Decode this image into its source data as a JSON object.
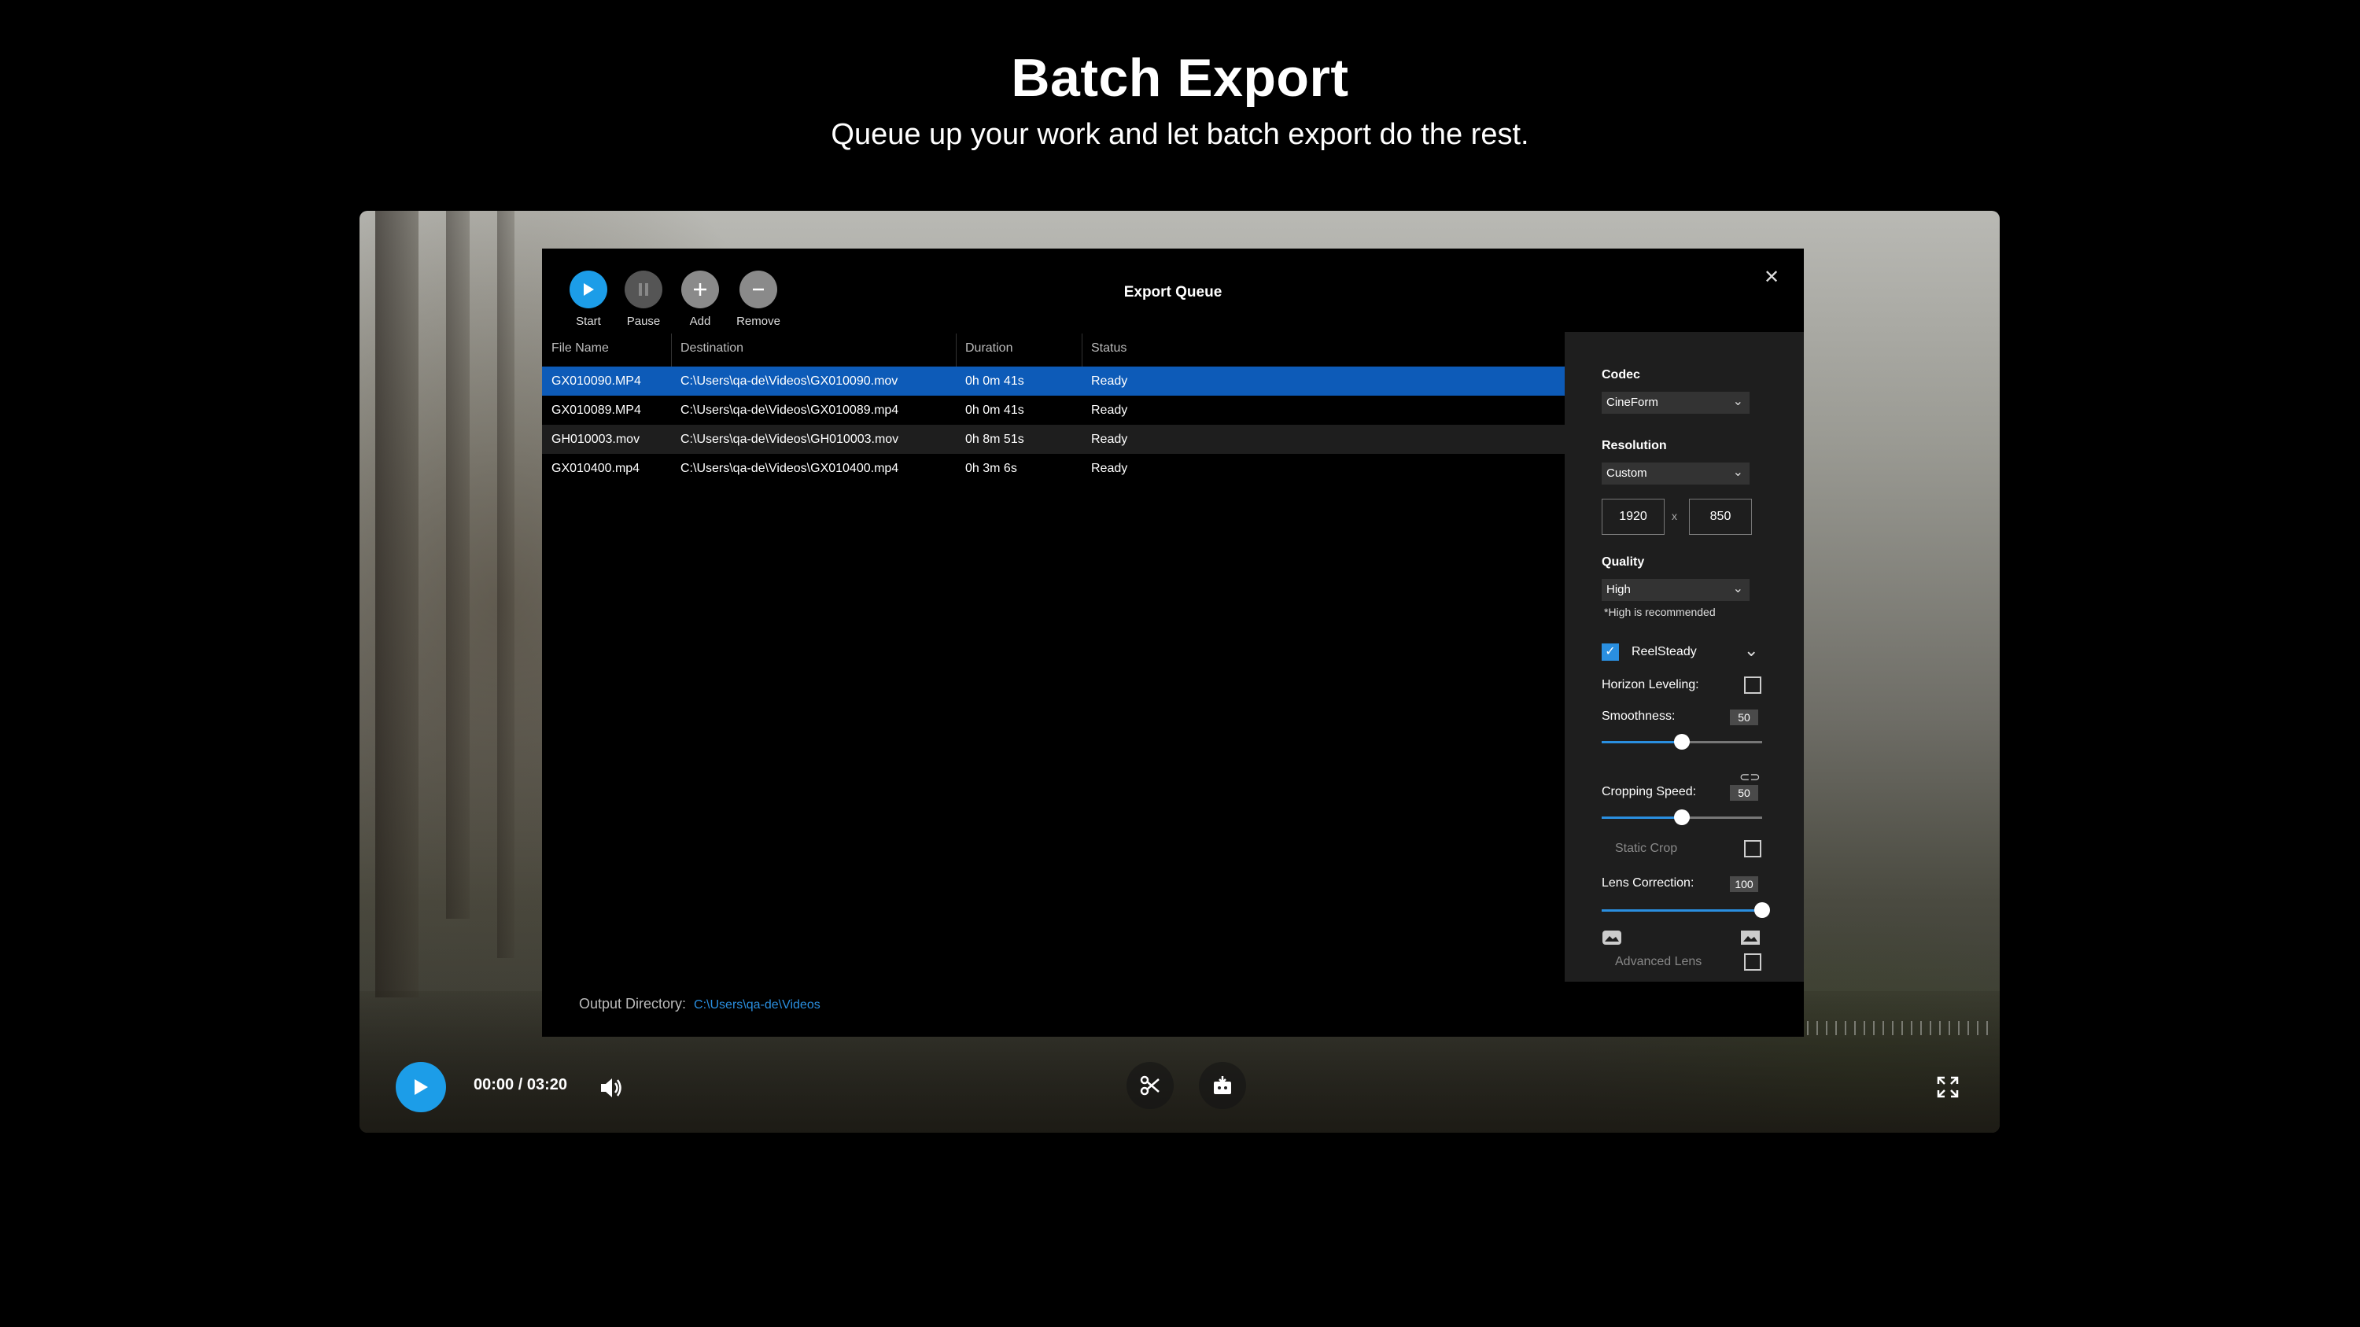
{
  "hero": {
    "title": "Batch Export",
    "subtitle": "Queue up your work and let batch export do the rest."
  },
  "modal": {
    "title": "Export Queue",
    "toolbar": {
      "start": "Start",
      "pause": "Pause",
      "add": "Add",
      "remove": "Remove"
    },
    "columns": [
      "File Name",
      "Destination",
      "Duration",
      "Status"
    ],
    "rows": [
      {
        "file": "GX010090.MP4",
        "dest": "C:\\Users\\qa-de\\Videos\\GX010090.mov",
        "duration": "0h 0m 41s",
        "status": "Ready"
      },
      {
        "file": "GX010089.MP4",
        "dest": "C:\\Users\\qa-de\\Videos\\GX010089.mp4",
        "duration": "0h 0m 41s",
        "status": "Ready"
      },
      {
        "file": "GH010003.mov",
        "dest": "C:\\Users\\qa-de\\Videos\\GH010003.mov",
        "duration": "0h 8m 51s",
        "status": "Ready"
      },
      {
        "file": "GX010400.mp4",
        "dest": "C:\\Users\\qa-de\\Videos\\GX010400.mp4",
        "duration": "0h 3m 6s",
        "status": "Ready"
      }
    ],
    "output": {
      "label": "Output Directory:",
      "path": "C:\\Users\\qa-de\\Videos"
    }
  },
  "settings": {
    "codec_label": "Codec",
    "codec_value": "CineForm",
    "resolution_label": "Resolution",
    "resolution_value": "Custom",
    "width": "1920",
    "times": "x",
    "height": "850",
    "quality_label": "Quality",
    "quality_value": "High",
    "quality_note": "*High is recommended",
    "reelsteady_label": "ReelSteady",
    "reelsteady_checked": true,
    "horizon_label": "Horizon Leveling:",
    "smoothness_label": "Smoothness:",
    "smoothness_value": "50",
    "smoothness_level": 50,
    "cropping_label": "Cropping Speed:",
    "cropping_value": "50",
    "cropping_level": 50,
    "static_crop_label": "Static Crop",
    "lens_label": "Lens Correction:",
    "lens_value": "100",
    "lens_level": 100,
    "advanced_lens_label": "Advanced Lens"
  },
  "player": {
    "time": "00:00 / 03:20"
  },
  "colors": {
    "accent": "#1c9de8",
    "selected_row": "#0d5bb8"
  }
}
